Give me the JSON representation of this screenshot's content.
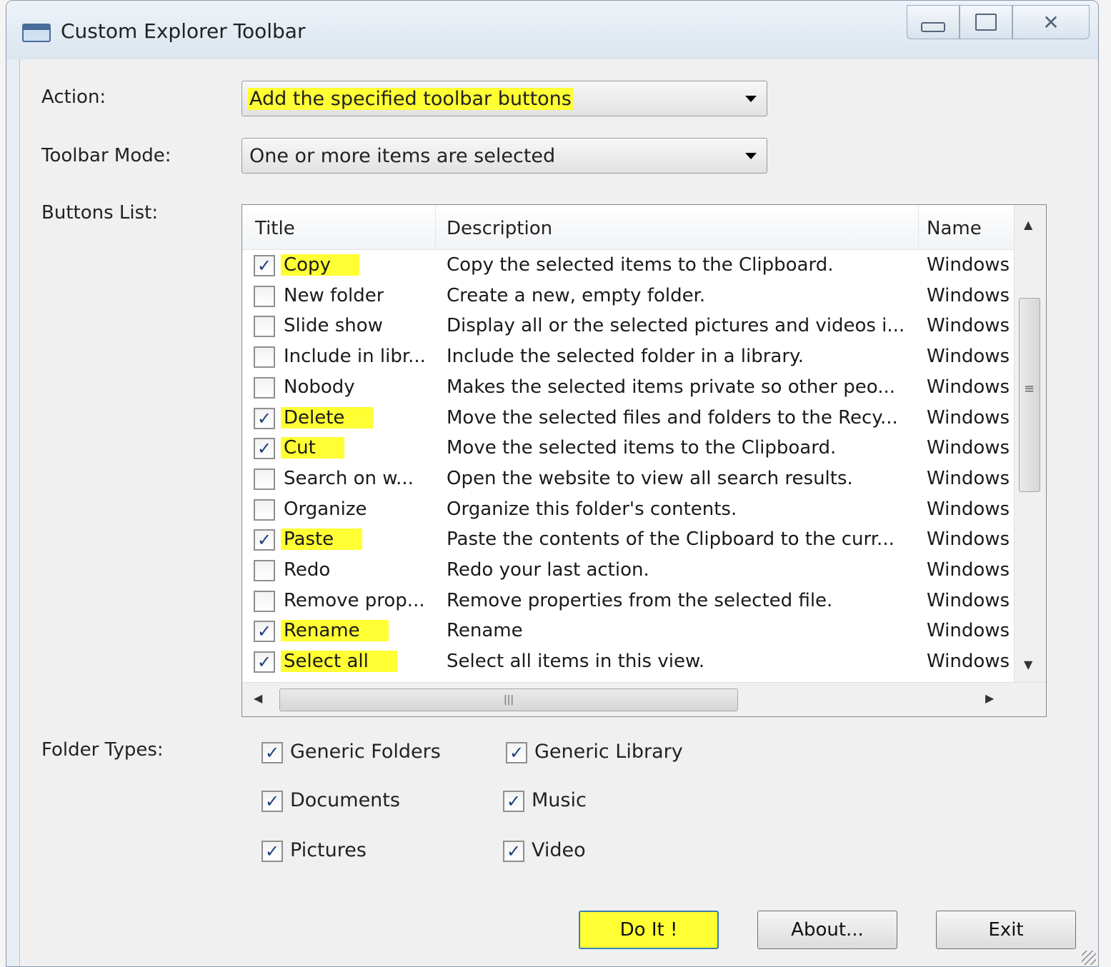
{
  "window": {
    "title": "Custom Explorer Toolbar"
  },
  "titlebar": {
    "minimize_icon": "minimize-icon",
    "maximize_icon": "maximize-icon",
    "close_icon": "close-icon",
    "close_glyph": "✕"
  },
  "action": {
    "label": "Action:",
    "value": "Add the specified toolbar buttons"
  },
  "toolbar_mode": {
    "label": "Toolbar Mode:",
    "value": "One or more items are selected"
  },
  "buttons_list": {
    "label": "Buttons List:",
    "columns": [
      "Title",
      "Description",
      "Name"
    ],
    "rows": [
      {
        "checked": true,
        "title": "Copy",
        "description": "Copy the selected items to the Clipboard.",
        "name": "Windows"
      },
      {
        "checked": false,
        "title": "New folder",
        "description": "Create a new, empty folder.",
        "name": "Windows"
      },
      {
        "checked": false,
        "title": "Slide show",
        "description": "Display all or the selected pictures and videos i...",
        "name": "Windows"
      },
      {
        "checked": false,
        "title": "Include in libr...",
        "description": "Include the selected folder in a library.",
        "name": "Windows"
      },
      {
        "checked": false,
        "title": "Nobody",
        "description": "Makes the selected items private so other peo...",
        "name": "Windows"
      },
      {
        "checked": true,
        "title": "Delete",
        "description": "Move the selected files and folders to the Recy...",
        "name": "Windows"
      },
      {
        "checked": true,
        "title": "Cut",
        "description": "Move the selected items to the Clipboard.",
        "name": "Windows"
      },
      {
        "checked": false,
        "title": "Search on w...",
        "description": "Open the website to view all search results.",
        "name": "Windows"
      },
      {
        "checked": false,
        "title": "Organize",
        "description": "Organize this folder's contents.",
        "name": "Windows"
      },
      {
        "checked": true,
        "title": "Paste",
        "description": "Paste the contents of the Clipboard to the curr...",
        "name": "Windows"
      },
      {
        "checked": false,
        "title": "Redo",
        "description": "Redo your last action.",
        "name": "Windows"
      },
      {
        "checked": false,
        "title": "Remove prop...",
        "description": "Remove properties from the selected file.",
        "name": "Windows"
      },
      {
        "checked": true,
        "title": "Rename",
        "description": "Rename",
        "name": "Windows"
      },
      {
        "checked": true,
        "title": "Select all",
        "description": "Select all items in this view.",
        "name": "Windows"
      }
    ],
    "scroll_up_glyph": "▲",
    "scroll_down_glyph": "▼",
    "scroll_left_glyph": "◀",
    "scroll_right_glyph": "▶",
    "hthumb_grip": "|||",
    "vthumb_grip": "≡"
  },
  "folder_types": {
    "label": "Folder Types:",
    "items": [
      {
        "label": "Generic Folders",
        "checked": true
      },
      {
        "label": "Generic Library",
        "checked": true
      },
      {
        "label": "Documents",
        "checked": true
      },
      {
        "label": "Music",
        "checked": true
      },
      {
        "label": "Pictures",
        "checked": true
      },
      {
        "label": "Video",
        "checked": true
      }
    ]
  },
  "check_glyph": "✓",
  "actions": {
    "do_it": "Do It !",
    "about": "About...",
    "exit": "Exit"
  },
  "colors": {
    "highlight": "#ffff33",
    "window_border": "#8a9aae",
    "client_bg": "#f0f0f0"
  }
}
